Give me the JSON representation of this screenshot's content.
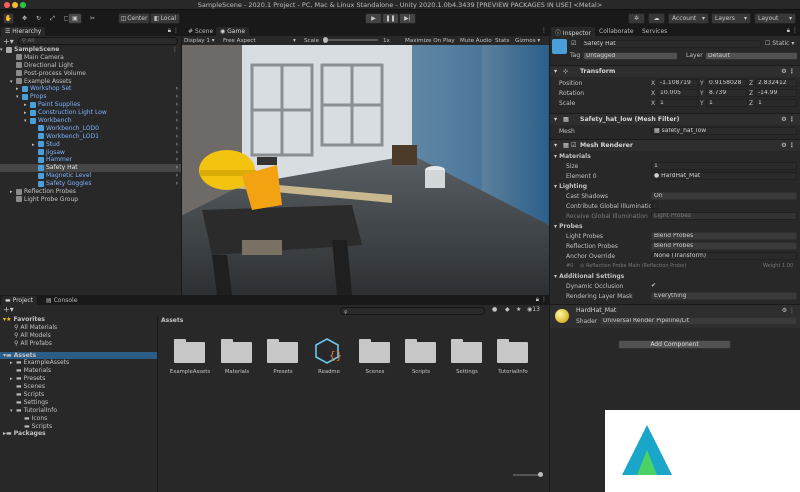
{
  "window": {
    "title": "SampleScene - 2020.1 Project - PC, Mac & Linux Standalone - Unity 2020.1.0b4.3439 [PREVIEW PACKAGES IN USE] <Metal>"
  },
  "toolbar": {
    "pivot_label": "Center",
    "space_label": "Local",
    "account_label": "Account",
    "layers_label": "Layers",
    "layout_label": "Layout"
  },
  "hierarchy": {
    "tab_label": "Hierarchy",
    "search_placeholder": "All",
    "items": [
      {
        "label": "SampleScene",
        "style": "scene"
      },
      {
        "label": "Main Camera",
        "style": "normal"
      },
      {
        "label": "Directional Light",
        "style": "normal"
      },
      {
        "label": "Post-process Volume",
        "style": "normal"
      },
      {
        "label": "Example Assets",
        "style": "normal"
      },
      {
        "label": "Workshop Set",
        "style": "prefab"
      },
      {
        "label": "Props",
        "style": "prefab"
      },
      {
        "label": "Paint Supplies",
        "style": "prefab"
      },
      {
        "label": "Construction Light Low",
        "style": "prefab"
      },
      {
        "label": "Workbench",
        "style": "prefab"
      },
      {
        "label": "Workbench_LOD0",
        "style": "prefab"
      },
      {
        "label": "Workbench_LOD1",
        "style": "prefab"
      },
      {
        "label": "Stud",
        "style": "prefab"
      },
      {
        "label": "Jigsaw",
        "style": "prefab"
      },
      {
        "label": "Hammer",
        "style": "prefab"
      },
      {
        "label": "Safety Hat",
        "style": "selected"
      },
      {
        "label": "Magnetic Level",
        "style": "prefab"
      },
      {
        "label": "Safety Goggles",
        "style": "prefab"
      },
      {
        "label": "Reflection Probes",
        "style": "normal"
      },
      {
        "label": "Light Probe Group",
        "style": "normal"
      }
    ]
  },
  "scene_view": {
    "tabs": [
      "Scene",
      "Game"
    ],
    "display": "Display 1",
    "aspect": "Free Aspect",
    "scale_label": "Scale",
    "scale_value": "1x",
    "maximize_label": "Maximize On Play",
    "mute_label": "Mute Audio",
    "stats_label": "Stats",
    "gizmos_label": "Gizmos"
  },
  "project": {
    "tabs": [
      "Project",
      "Console"
    ],
    "hidden_count": "13",
    "favorites_label": "Favorites",
    "favorites": [
      "All Materials",
      "All Models",
      "All Prefabs"
    ],
    "assets_label": "Assets",
    "asset_tree": [
      "ExampleAssets",
      "Materials",
      "Presets",
      "Scenes",
      "Scripts",
      "Settings",
      "TutorialInfo",
      "Icons",
      "Scripts"
    ],
    "packages_label": "Packages",
    "breadcrumb": "Assets",
    "grid": [
      "ExampleAssets",
      "Materials",
      "Presets",
      "Readme",
      "Scenes",
      "Scripts",
      "Settings",
      "TutorialInfo"
    ]
  },
  "inspector": {
    "tabs": [
      "Inspector",
      "Collaborate",
      "Services"
    ],
    "object_name": "Safety Hat",
    "static_label": "Static",
    "tag_label": "Tag",
    "tag_value": "Untagged",
    "layer_label": "Layer",
    "layer_value": "Default",
    "transform": {
      "title": "Transform",
      "position_label": "Position",
      "rotation_label": "Rotation",
      "scale_label": "Scale",
      "position": [
        "-1.108719",
        "0.9158028",
        "2.832412"
      ],
      "rotation": [
        "10.005",
        "8.739",
        "-14.99"
      ],
      "scale": [
        "1",
        "1",
        "1"
      ]
    },
    "mesh_filter": {
      "title": "Safety_hat_low (Mesh Filter)",
      "mesh_label": "Mesh",
      "mesh_value": "safety_hat_low"
    },
    "mesh_renderer": {
      "title": "Mesh Renderer",
      "materials_label": "Materials",
      "size_label": "Size",
      "size_value": "1",
      "element_label": "Element 0",
      "element_value": "HardHat_Mat",
      "lighting_label": "Lighting",
      "cast_shadows_label": "Cast Shadows",
      "cast_shadows_value": "On",
      "contribute_gi_label": "Contribute Global Illumination",
      "receive_gi_label": "Receive Global Illumination",
      "receive_gi_value": "Light Probes",
      "probes_label": "Probes",
      "light_probes_label": "Light Probes",
      "light_probes_value": "Blend Probes",
      "reflection_probes_label": "Reflection Probes",
      "reflection_probes_value": "Blend Probes",
      "anchor_label": "Anchor Override",
      "anchor_value": "None (Transform)",
      "probe_info_prefix": "#0",
      "probe_info": "Reflection Probe Main (Reflection Probe)",
      "probe_weight": "Weight 1.00",
      "additional_label": "Additional Settings",
      "dynamic_occlusion_label": "Dynamic Occlusion",
      "rendering_layer_label": "Rendering Layer Mask",
      "rendering_layer_value": "Everything"
    },
    "material": {
      "name": "HardHat_Mat",
      "shader_label": "Shader",
      "shader_value": "Universal Render Pipeline/Lit"
    },
    "add_component_label": "Add Component"
  },
  "colors": {
    "accent_blue": "#7fb2ff",
    "panel": "#282828",
    "dark": "#191919",
    "selection": "#464646"
  }
}
